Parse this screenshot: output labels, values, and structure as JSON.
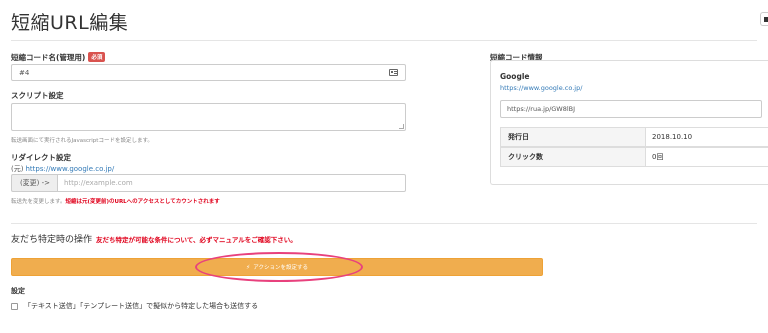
{
  "page": {
    "title": "短縮URL編集"
  },
  "form": {
    "short_code_name": {
      "label": "短縮コード名(管理用)",
      "required_badge": "必須",
      "value": "#4"
    },
    "script": {
      "label": "スクリプト設定",
      "help": "転送画面にて実行されるJavascriptコードを設定します。"
    },
    "redirect": {
      "label": "リダイレクト設定",
      "original_label": "(元)",
      "original_url": "https://www.google.co.jp/",
      "addon": "(変更) ->",
      "placeholder": "http://example.com",
      "help_prefix": "転送先を変更します。",
      "help_warning": "短縮は元(変更前)のURLへのアクセスとしてカウントされます"
    }
  },
  "info_panel": {
    "heading": "短縮コード情報",
    "site_name": "Google",
    "site_url": "https://www.google.co.jp/",
    "short_url": "https://rua.jp/GW8lBJ",
    "stats": [
      {
        "label": "発行日",
        "value": "2018.10.10"
      },
      {
        "label": "クリック数",
        "value": "0回"
      }
    ]
  },
  "friend_section": {
    "title": "友だち特定時の操作",
    "note": "友だち特定が可能な条件について、必ずマニュアルをご確認下さい。",
    "action_button": "アクションを設定する",
    "settings_label": "設定",
    "checkbox_label": "「テキスト送信」「テンプレート送信」で擬似から特定した場合も送信する"
  },
  "colors": {
    "accent": "#f0ad4e",
    "link": "#337ab7",
    "warning": "#e0001b",
    "highlight": "#e8417d"
  },
  "icons": {
    "short_code_input": "id-card-icon",
    "action_button": "bolt-icon"
  }
}
